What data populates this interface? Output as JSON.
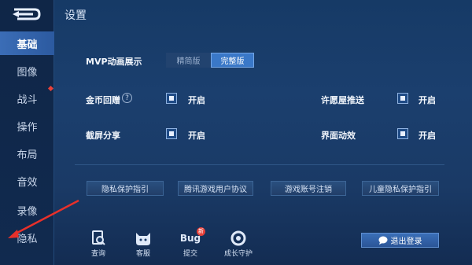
{
  "header": {
    "title": "设置"
  },
  "sidebar": {
    "items": [
      {
        "label": "基础",
        "active": true
      },
      {
        "label": "图像",
        "active": false
      },
      {
        "label": "战斗",
        "active": false,
        "badge": true
      },
      {
        "label": "操作",
        "active": false
      },
      {
        "label": "布局",
        "active": false
      },
      {
        "label": "音效",
        "active": false
      },
      {
        "label": "录像",
        "active": false
      },
      {
        "label": "隐私",
        "active": false
      }
    ]
  },
  "settings": {
    "mvp": {
      "label": "MVP动画展示",
      "options": [
        "精简版",
        "完整版"
      ],
      "selected": "完整版"
    },
    "coin_reward": {
      "label": "金币回赠",
      "value_label": "开启",
      "checked": true
    },
    "wish_push": {
      "label": "许愿屋推送",
      "value_label": "开启",
      "checked": true
    },
    "screenshot_share": {
      "label": "截屏分享",
      "value_label": "开启",
      "checked": true
    },
    "ui_effects": {
      "label": "界面动效",
      "value_label": "开启",
      "checked": true
    }
  },
  "links": [
    "隐私保护指引",
    "腾讯游戏用户协议",
    "游戏账号注销",
    "儿童隐私保护指引"
  ],
  "tools": [
    {
      "label": "查询",
      "icon": "query-icon"
    },
    {
      "label": "客服",
      "icon": "customer-service-icon"
    },
    {
      "label": "提交",
      "icon": "bug-icon",
      "icon_text": "Bug",
      "badge": "新"
    },
    {
      "label": "成长守护",
      "icon": "growth-guard-icon"
    }
  ],
  "logout": {
    "label": "退出登录",
    "icon": "chat-icon"
  },
  "colors": {
    "accent": "#2c5aa0",
    "badge_red": "#e8413a",
    "annotation_arrow": "#e8302a"
  }
}
